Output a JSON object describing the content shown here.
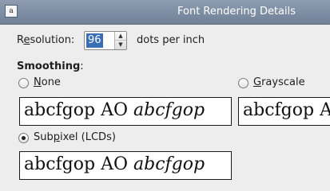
{
  "window": {
    "title": "Font Rendering Details",
    "icon": "font-app-icon",
    "icon_glyph": "a"
  },
  "resolution": {
    "label_pre": "R",
    "label_mnemonic": "e",
    "label_post": "solution:",
    "value": "96",
    "unit_label": "dots per inch"
  },
  "smoothing": {
    "heading_pre": "Smoothing",
    "heading_colon": ":",
    "options": [
      {
        "label_pre": "",
        "label_mnemonic": "N",
        "label_post": "one",
        "checked": false
      },
      {
        "label_pre": "",
        "label_mnemonic": "G",
        "label_post": "rayscale",
        "checked": false
      },
      {
        "label_pre": "Sub",
        "label_mnemonic": "p",
        "label_post": "ixel (LCDs)",
        "checked": true
      }
    ],
    "sample_roman": "abcfgop AO",
    "sample_italic": "abcfgop"
  }
}
